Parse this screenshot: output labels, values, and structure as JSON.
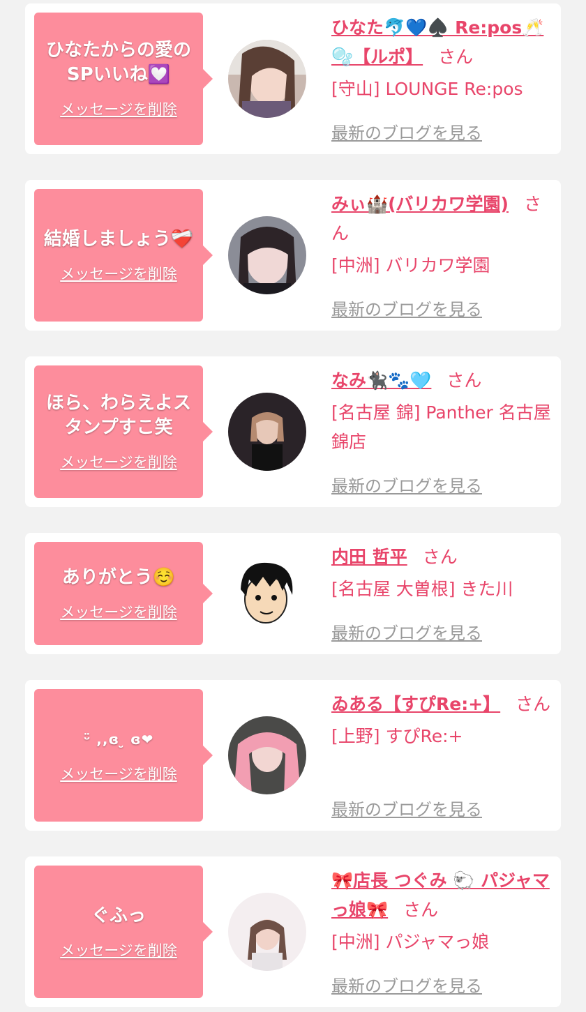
{
  "colors": {
    "bubble": "#fd8d9c",
    "accent": "#e8456a",
    "muted": "#9a9a9a"
  },
  "items": [
    {
      "message": "ひなたからの愛のSPいいね💟",
      "delete_label": "メッセージを削除",
      "name": "ひなた🐬💙♠️ Re:pos🥂🫧【ルポ】",
      "honorific": "さん",
      "shop": "[守山] LOUNGE Re:pos",
      "blog_label": "最新のブログを見る",
      "avatar_icon": "avatar-photo"
    },
    {
      "message": "結婚しましょう❤️‍🩹",
      "delete_label": "メッセージを削除",
      "name": "みぃ🏰(バリカワ学園)",
      "honorific": "さん",
      "shop": "[中洲] バリカワ学園",
      "blog_label": "最新のブログを見る",
      "avatar_icon": "avatar-photo"
    },
    {
      "message": "ほら、わらえよスタンプすこ笑",
      "delete_label": "メッセージを削除",
      "name": "なみ🐈‍⬛🐾🩵",
      "honorific": "さん",
      "shop": "[名古屋 錦] Panther 名古屋錦店",
      "blog_label": "最新のブログを見る",
      "avatar_icon": "avatar-photo"
    },
    {
      "message": "ありがとう☺️",
      "delete_label": "メッセージを削除",
      "name": "内田 哲平",
      "honorific": "さん",
      "shop": "[名古屋 大曽根] きた川",
      "blog_label": "最新のブログを見る",
      "avatar_icon": "avatar-illustration"
    },
    {
      "message": "ᵕ̈ ,,ɞ ̮ ɞ❤",
      "delete_label": "メッセージを削除",
      "name": "ゐある【すぴRe:+】",
      "honorific": "さん",
      "shop": "[上野] すぴRe:+",
      "blog_label": "最新のブログを見る",
      "avatar_icon": "avatar-photo"
    },
    {
      "message": "ぐふっ",
      "delete_label": "メッセージを削除",
      "name": "🎀店長 つぐみ 🐑 パジャマっ娘🎀",
      "honorific": "さん",
      "shop": "[中洲] パジャマっ娘",
      "blog_label": "最新のブログを見る",
      "avatar_icon": "avatar-photo"
    }
  ]
}
